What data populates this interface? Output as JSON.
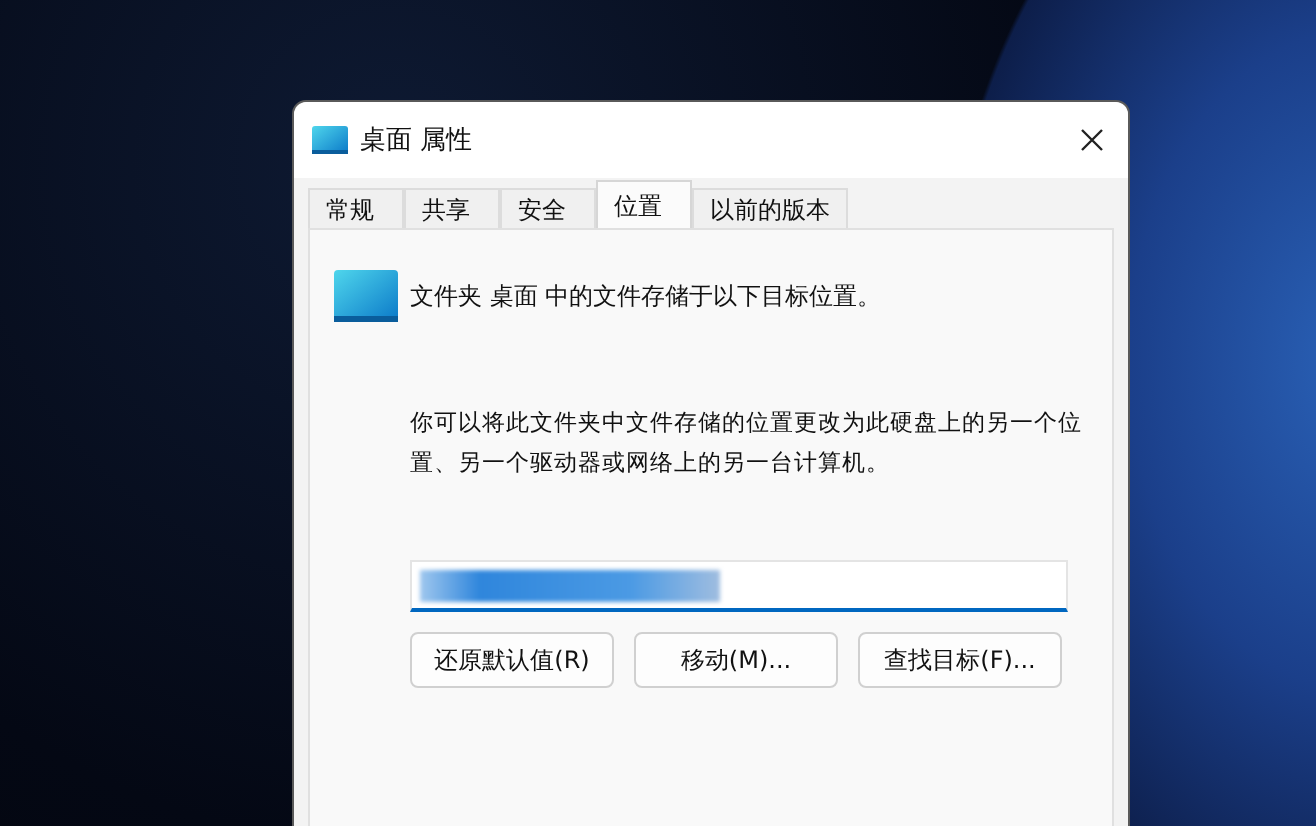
{
  "window": {
    "title": "桌面 属性"
  },
  "tabs": [
    {
      "label": "常规",
      "selected": false
    },
    {
      "label": "共享",
      "selected": false
    },
    {
      "label": "安全",
      "selected": false
    },
    {
      "label": "位置",
      "selected": true
    },
    {
      "label": "以前的版本",
      "selected": false
    }
  ],
  "location": {
    "heading": "文件夹 桌面 中的文件存储于以下目标位置。",
    "description": "你可以将此文件夹中文件存储的位置更改为此硬盘上的另一个位置、另一个驱动器或网络上的另一台计算机。"
  },
  "buttons": [
    "还原默认值(R)",
    "移动(M)...",
    "查找目标(F)..."
  ]
}
